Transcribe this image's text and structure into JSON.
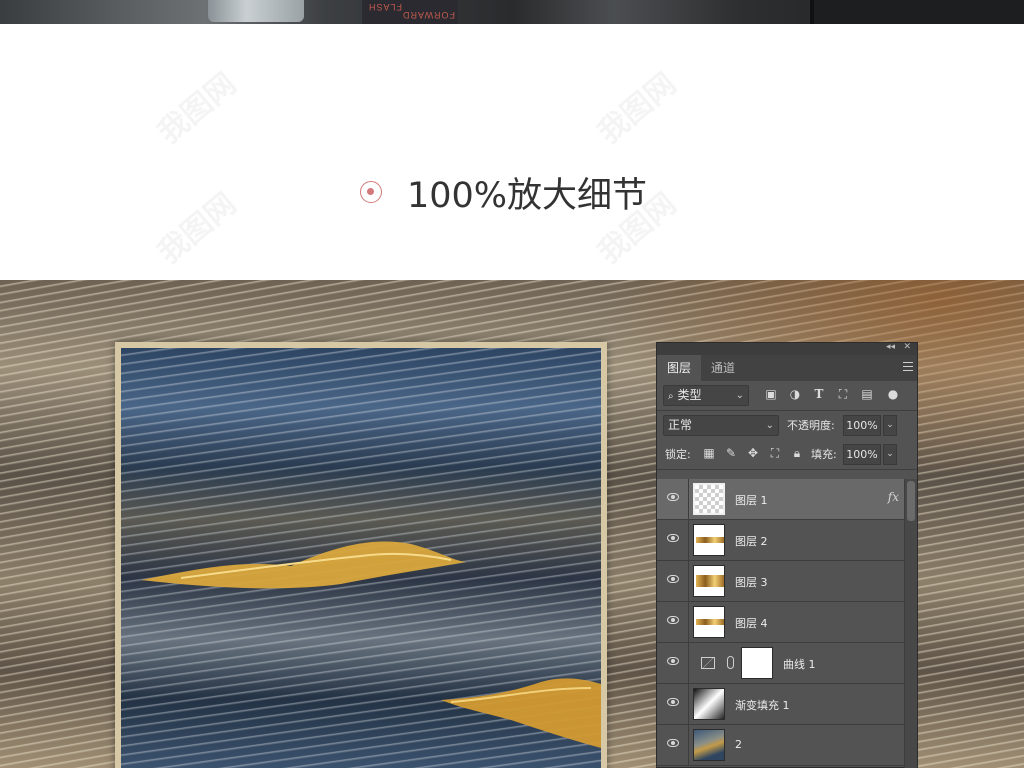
{
  "top_strip": {
    "book_text_1": "FLASH",
    "book_text_2": "FORWARD"
  },
  "watermark": "我图网",
  "heading": {
    "title": "100%放大细节",
    "accent_color": "#d4797a"
  },
  "layers_panel": {
    "tabs": [
      "图层",
      "通道"
    ],
    "filter": {
      "search_icon": "search-icon",
      "kind_label": "类型"
    },
    "blend_mode": "正常",
    "opacity_label": "不透明度:",
    "opacity_value": "100%",
    "lock_label": "锁定:",
    "fill_label": "填充:",
    "fill_value": "100%",
    "layers": [
      {
        "name": "图层 1",
        "thumb": "transparent",
        "selected": true,
        "fx": "fx"
      },
      {
        "name": "图层 2",
        "thumb": "gold-strip"
      },
      {
        "name": "图层 3",
        "thumb": "gold-strip"
      },
      {
        "name": "图层 4",
        "thumb": "gold-strip"
      },
      {
        "name": "曲线 1",
        "thumb": "curves-adjustment"
      },
      {
        "name": "渐变填充 1",
        "thumb": "gradient"
      },
      {
        "name": "2",
        "thumb": "artwork"
      }
    ],
    "colors": {
      "panel_bg": "#535353",
      "selected_row": "#696969"
    }
  }
}
